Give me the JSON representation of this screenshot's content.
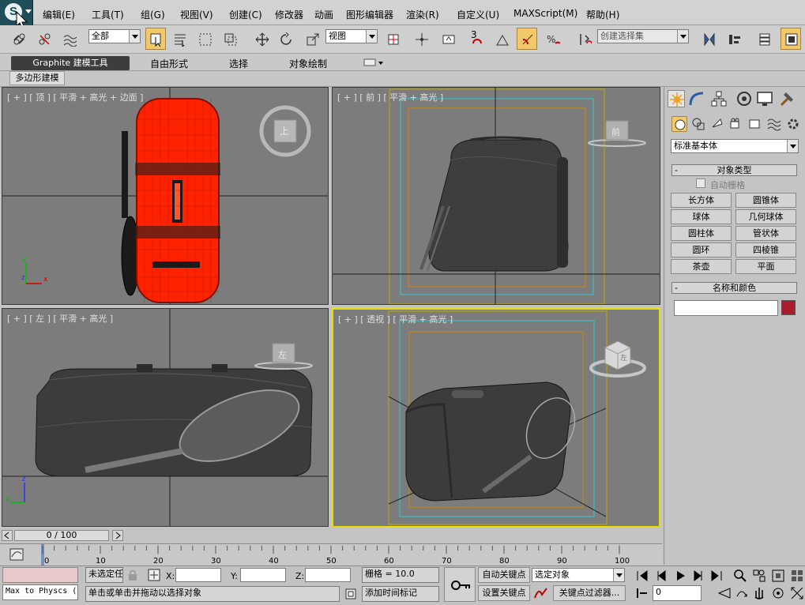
{
  "menu": {
    "items": [
      "编辑(E)",
      "工具(T)",
      "组(G)",
      "视图(V)",
      "创建(C)",
      "修改器",
      "动画",
      "图形编辑器",
      "渲染(R)",
      "自定义(U)",
      "MAXScript(M)",
      "帮助(H)"
    ]
  },
  "toolbar": {
    "selection_filter": "全部",
    "reference_coord": "视图",
    "named_selection_placeholder": "创建选择集",
    "snap_label": "3",
    "angle_snap_label": "%",
    "icons": [
      "link-icon",
      "unlink-icon",
      "bind-spacewarp-icon",
      "select-object-icon",
      "select-by-name-icon",
      "rectangle-selection-icon",
      "window-crossing-icon",
      "move-icon",
      "rotate-icon",
      "scale-icon",
      "use-pivot-icon",
      "manipulate-icon",
      "keyboard-shortcut-icon",
      "snap-icon",
      "angle-snap-icon",
      "percent-snap-icon",
      "spinner-snap-icon",
      "edit-named-selection-icon",
      "mirror-icon",
      "align-icon",
      "layer-manager-icon",
      "graphite-toggle-icon"
    ]
  },
  "ribbon": {
    "tabs": [
      "Graphite 建模工具",
      "自由形式",
      "选择",
      "对象绘制"
    ],
    "sub_tab": "多边形建模"
  },
  "viewports": {
    "top": {
      "label": "[ + ] [ 顶 ] [ 平滑 + 高光 + 边面 ]",
      "cube_label": "上"
    },
    "front": {
      "label": "[ + ] [ 前 ] [ 平滑 + 高光 ]",
      "cube_label": "前"
    },
    "left": {
      "label": "[ + ] [ 左 ] [ 平滑 + 高光 ]",
      "cube_label": "左"
    },
    "persp": {
      "label": "[ + ] [ 透视 ] [ 平滑 + 高光 ]",
      "cube_label": "左"
    }
  },
  "command_panel": {
    "category": "标准基本体",
    "object_type_title": "对象类型",
    "auto_grid": "自动栅格",
    "buttons": [
      "长方体",
      "圆锥体",
      "球体",
      "几何球体",
      "圆柱体",
      "管状体",
      "圆环",
      "四棱锥",
      "茶壶",
      "平面"
    ],
    "name_color_title": "名称和颜色",
    "name_value": "",
    "swatch_color": "#a81c2c"
  },
  "timeline": {
    "frame_counter": "0 / 100",
    "ticks": [
      "0",
      "10",
      "20",
      "30",
      "40",
      "50",
      "60",
      "70",
      "80",
      "90",
      "100"
    ]
  },
  "status": {
    "maxscript_listener": "Max to Physcs (",
    "selection_status": "未选定任",
    "x_label": "X:",
    "y_label": "Y:",
    "z_label": "Z:",
    "grid": "栅格 = 10.0",
    "prompt": "单击或单击并拖动以选择对象",
    "add_time_tag": "添加时间标记",
    "auto_key": "自动关键点",
    "set_key": "设置关键点",
    "key_target": "选定对象",
    "key_filters": "关键点过滤器...",
    "current_frame": "0"
  },
  "colors": {
    "viewport_bg": "#7c7c7c",
    "active_border": "#e8e000",
    "selection_red": "#ff2200"
  }
}
